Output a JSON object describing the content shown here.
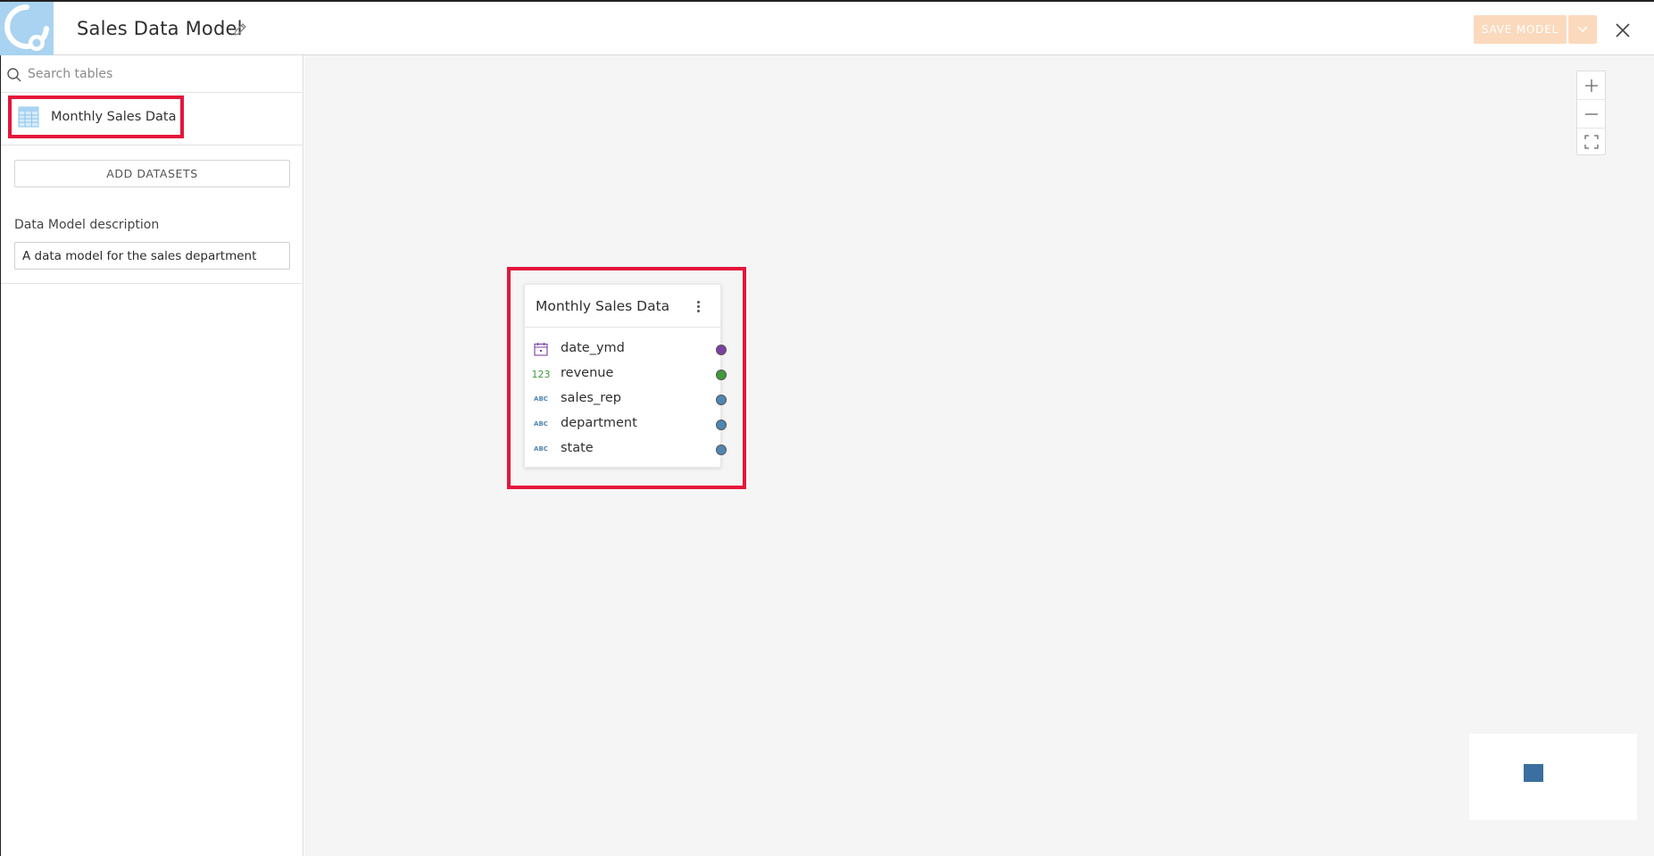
{
  "header": {
    "title": "Sales Data Model",
    "save_label": "SAVE MODEL"
  },
  "sidebar": {
    "search_placeholder": "Search tables",
    "tables": [
      {
        "label": "Monthly Sales Data"
      }
    ],
    "add_datasets_label": "ADD DATASETS",
    "description_label": "Data Model description",
    "description_value": "A data model for the sales department"
  },
  "canvas": {
    "node": {
      "title": "Monthly Sales Data",
      "fields": [
        {
          "name": "date_ymd",
          "type_icon": "calendar-icon",
          "port_color": "#7b3fa0"
        },
        {
          "name": "revenue",
          "type_label": "123",
          "type_icon": "number-type-icon",
          "port_color": "#3f9a3a"
        },
        {
          "name": "sales_rep",
          "type_label": "ABC",
          "type_icon": "text-type-icon",
          "port_color": "#4f86b3"
        },
        {
          "name": "department",
          "type_label": "ABC",
          "type_icon": "text-type-icon",
          "port_color": "#4f86b3"
        },
        {
          "name": "state",
          "type_label": "ABC",
          "type_icon": "text-type-icon",
          "port_color": "#4f86b3"
        }
      ]
    }
  },
  "colors": {
    "highlight": "#e4163a",
    "save_button": "#fbd9bd",
    "logo_bg": "#a9d3f0",
    "minimap_node": "#3a6f9f"
  }
}
